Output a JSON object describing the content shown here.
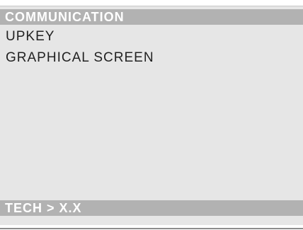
{
  "header": {
    "title": "COMMUNICATION"
  },
  "menu": {
    "items": [
      {
        "label": "UPKEY"
      },
      {
        "label": "GRAPHICAL SCREEN"
      }
    ]
  },
  "footer": {
    "path": "TECH > X.X"
  },
  "colors": {
    "screen_background": "#e6e6e6",
    "bar_background": "#b2b2b2",
    "bar_text": "#ffffff",
    "menu_text": "#222222"
  }
}
